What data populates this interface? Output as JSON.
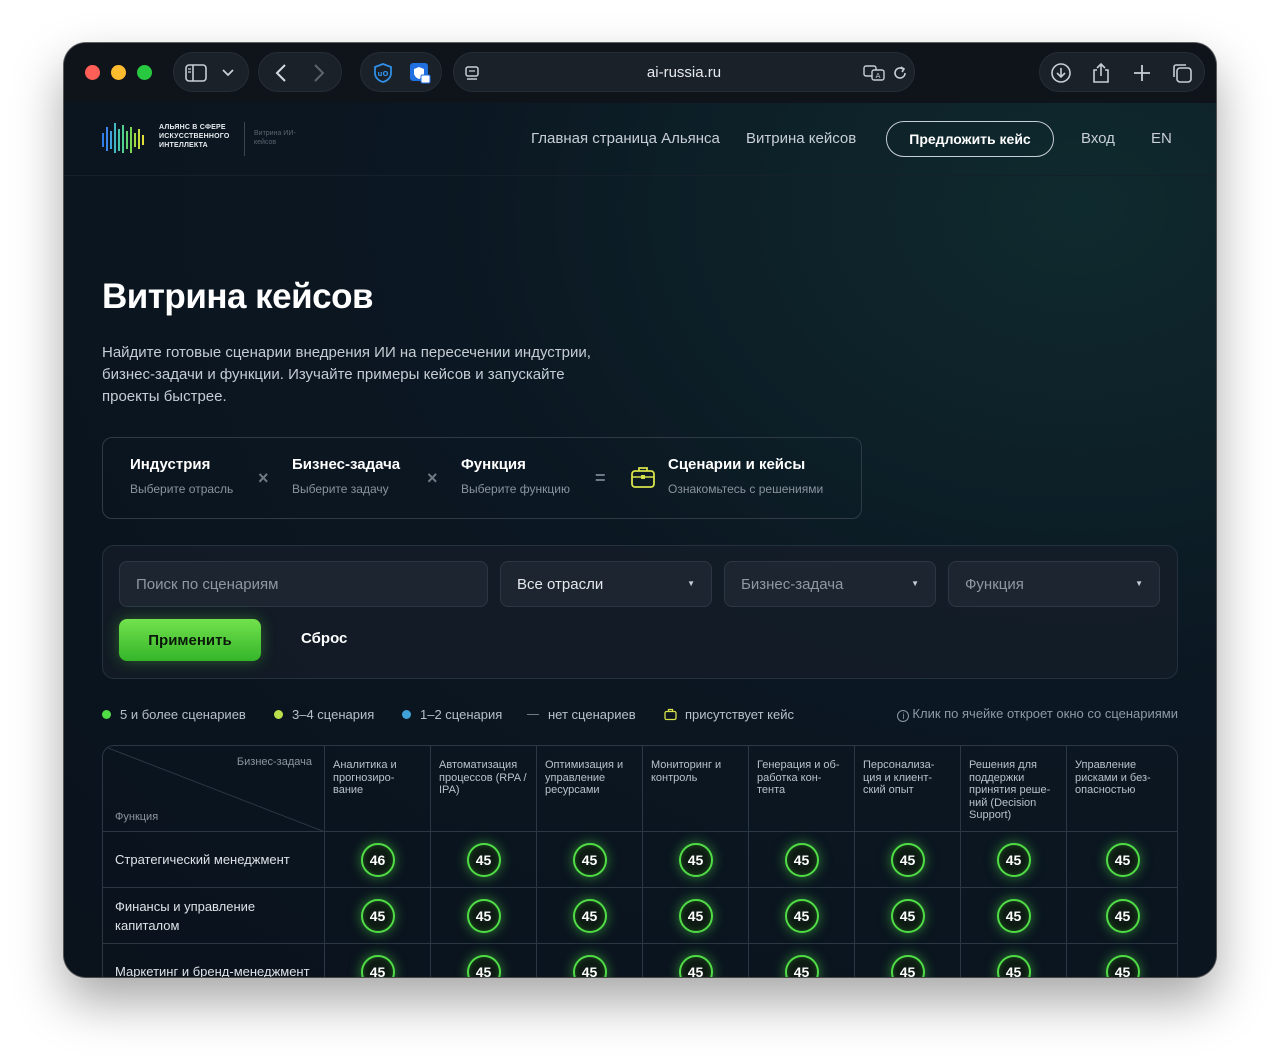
{
  "browser": {
    "url": "ai-russia.ru"
  },
  "site": {
    "logo_text": "АЛЬЯНС В СФЕРЕ ИСКУССТВЕННОГО ИНТЕЛЛЕКТА",
    "logo_sub": "Витрина ИИ-кейсов",
    "nav": {
      "home": "Главная страница Альянса",
      "showcase": "Витрина кейсов",
      "propose": "Предложить кейс",
      "login": "Вход",
      "lang": "EN"
    }
  },
  "hero": {
    "title": "Витрина кейсов",
    "description": "Найдите готовые сценарии внедрения ИИ на пересечении индустрии, бизнес-задачи и функции. Изучайте примеры кейсов и запускайте проекты быстрее."
  },
  "formula": {
    "industry": {
      "title": "Индустрия",
      "sub": "Выберите отрасль"
    },
    "task": {
      "title": "Бизнес-задача",
      "sub": "Выберите задачу"
    },
    "function": {
      "title": "Функция",
      "sub": "Выберите функцию"
    },
    "result": {
      "title": "Сценарии и кейсы",
      "sub": "Ознакомьтесь с решениями"
    },
    "op_times": "×",
    "op_equals": "="
  },
  "filters": {
    "search_placeholder": "Поиск по сценариям",
    "industry_value": "Все отрасли",
    "task_value": "Бизнес-задача",
    "function_value": "Функция",
    "apply": "Применить",
    "reset": "Сброс"
  },
  "legend": {
    "items": [
      {
        "label": "5 и более сценариев",
        "color": "#4fdc45"
      },
      {
        "label": "3–4 сценария",
        "color": "#b9e04a"
      },
      {
        "label": "1–2 сценария",
        "color": "#3fa2d8"
      },
      {
        "label": "нет сценариев",
        "color": "#6f7a84"
      },
      {
        "label": "присутствует кейс",
        "color": "#d8e24a"
      }
    ],
    "hint": "Клик по ячейке откроет окно со сценариями"
  },
  "matrix": {
    "corner_task": "Бизнес-задача",
    "corner_function": "Функция",
    "columns": [
      "Аналитика и прогнозиро-вание",
      "Автоматизация процессов (RPA / IPA)",
      "Оптимизация и управление ресурсами",
      "Мониторинг и контроль",
      "Генерация и об-работка кон-тента",
      "Персонализа-ция и клиент-ский опыт",
      "Решения для поддержки принятия реше-ний (Decision Support)",
      "Управление рисками и без-опасностью"
    ],
    "rows": [
      {
        "label": "Стратегический менеджмент",
        "values": [
          "46",
          "45",
          "45",
          "45",
          "45",
          "45",
          "45",
          "45"
        ]
      },
      {
        "label": "Финансы и управление капиталом",
        "values": [
          "45",
          "45",
          "45",
          "45",
          "45",
          "45",
          "45",
          "45"
        ]
      },
      {
        "label": "Маркетинг и бренд-менеджмент",
        "values": [
          "45",
          "45",
          "45",
          "45",
          "45",
          "45",
          "45",
          "45"
        ]
      }
    ]
  }
}
